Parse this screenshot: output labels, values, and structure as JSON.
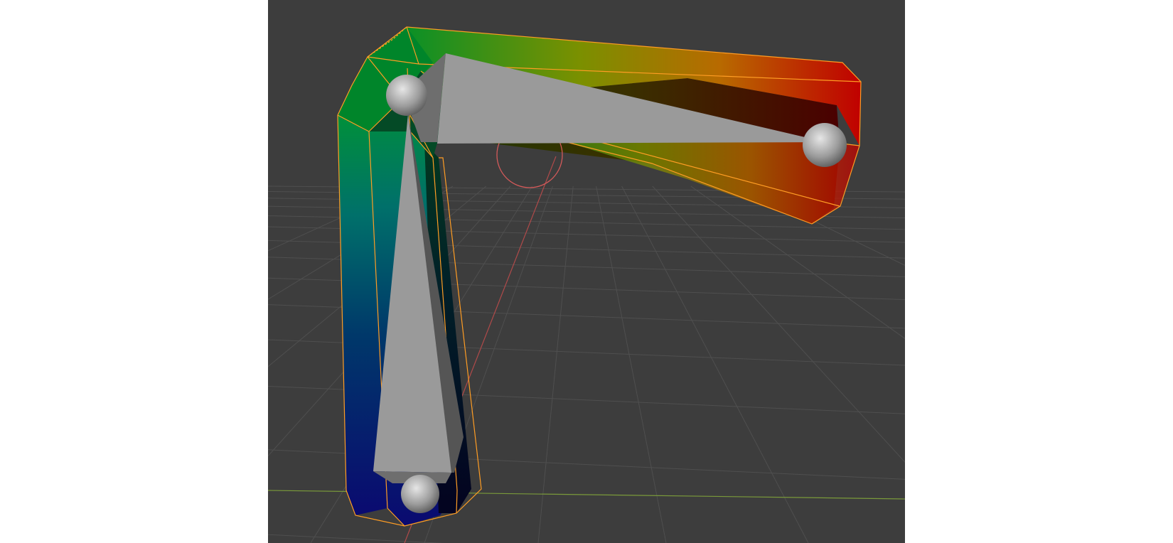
{
  "viewport": {
    "background": "#3d3d3d",
    "grid_color": "#4f4f4f",
    "x_axis_color": "#7a9a3a",
    "y_axis_color": "#b04a4a",
    "selection_outline_color": "#ff9d24",
    "bone_color": "#9a9a9a",
    "joint_color": "#b8b8b8",
    "cursor_color": "#d45a5a"
  },
  "mesh": {
    "name": "weight-painted-bent-mesh",
    "gradient_colors": [
      "#0a0a70",
      "#005a7a",
      "#00a040",
      "#8a9a00",
      "#c08000",
      "#c00000"
    ]
  },
  "armature": {
    "bones": [
      "bone-upright",
      "bone-horizontal"
    ],
    "joints": [
      "joint-base",
      "joint-elbow",
      "joint-tip"
    ]
  }
}
